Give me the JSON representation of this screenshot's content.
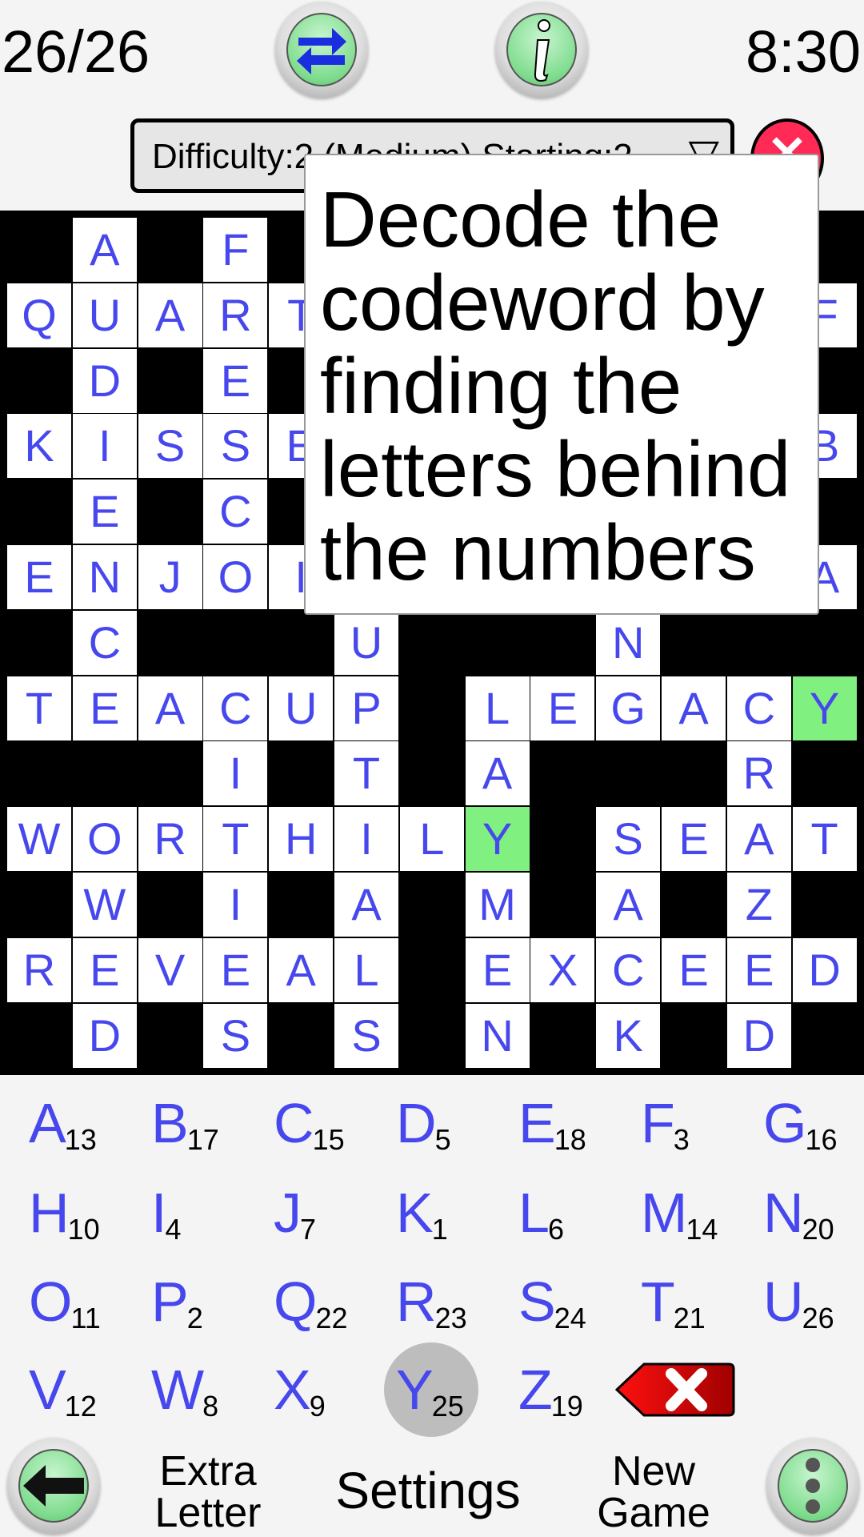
{
  "header": {
    "score": "26/26",
    "timer": "8:30",
    "swap_icon": "swap-arrows-icon",
    "info_icon": "info-icon"
  },
  "dropdown": {
    "value": "Difficulty:2  (Medium) Starting:2"
  },
  "popup": {
    "text": "Decode the codeword by finding the letters behind the numbers"
  },
  "colors": {
    "letter": "#4747ee",
    "highlight": "#80f080",
    "grid_bg": "#000000",
    "accent_green": "#7fdc8e",
    "close_red": "#ff2a55"
  },
  "grid": {
    "rows": [
      ".A.F.........",
      "QUART.......F",
      ".D.E.........",
      "KISSE.......B",
      ".E.C.........",
      "ENJOI.......A",
      ".C...U...N...",
      "TEACUP.LEGACY",
      "...I.T.A...R.",
      "WORTHILY.SEAT",
      ".W.I.A.M.A.Z.",
      "REVEAL.EXCEED",
      ".D.S.S.N.K.D."
    ],
    "highlighted": [
      [
        7,
        12
      ],
      [
        9,
        7
      ]
    ]
  },
  "keyboard": {
    "selected": "Y",
    "keys": [
      {
        "letter": "A",
        "number": "13"
      },
      {
        "letter": "B",
        "number": "17"
      },
      {
        "letter": "C",
        "number": "15"
      },
      {
        "letter": "D",
        "number": "5"
      },
      {
        "letter": "E",
        "number": "18"
      },
      {
        "letter": "F",
        "number": "3"
      },
      {
        "letter": "G",
        "number": "16"
      },
      {
        "letter": "H",
        "number": "10"
      },
      {
        "letter": "I",
        "number": "4"
      },
      {
        "letter": "J",
        "number": "7"
      },
      {
        "letter": "K",
        "number": "1"
      },
      {
        "letter": "L",
        "number": "6"
      },
      {
        "letter": "M",
        "number": "14"
      },
      {
        "letter": "N",
        "number": "20"
      },
      {
        "letter": "O",
        "number": "11"
      },
      {
        "letter": "P",
        "number": "2"
      },
      {
        "letter": "Q",
        "number": "22"
      },
      {
        "letter": "R",
        "number": "23"
      },
      {
        "letter": "S",
        "number": "24"
      },
      {
        "letter": "T",
        "number": "21"
      },
      {
        "letter": "U",
        "number": "26"
      },
      {
        "letter": "V",
        "number": "12"
      },
      {
        "letter": "W",
        "number": "8"
      },
      {
        "letter": "X",
        "number": "9"
      },
      {
        "letter": "Y",
        "number": "25"
      },
      {
        "letter": "Z",
        "number": "19"
      }
    ]
  },
  "bottom": {
    "extra_letter_line1": "Extra",
    "extra_letter_line2": "Letter",
    "settings": "Settings",
    "new_game_line1": "New",
    "new_game_line2": "Game"
  }
}
